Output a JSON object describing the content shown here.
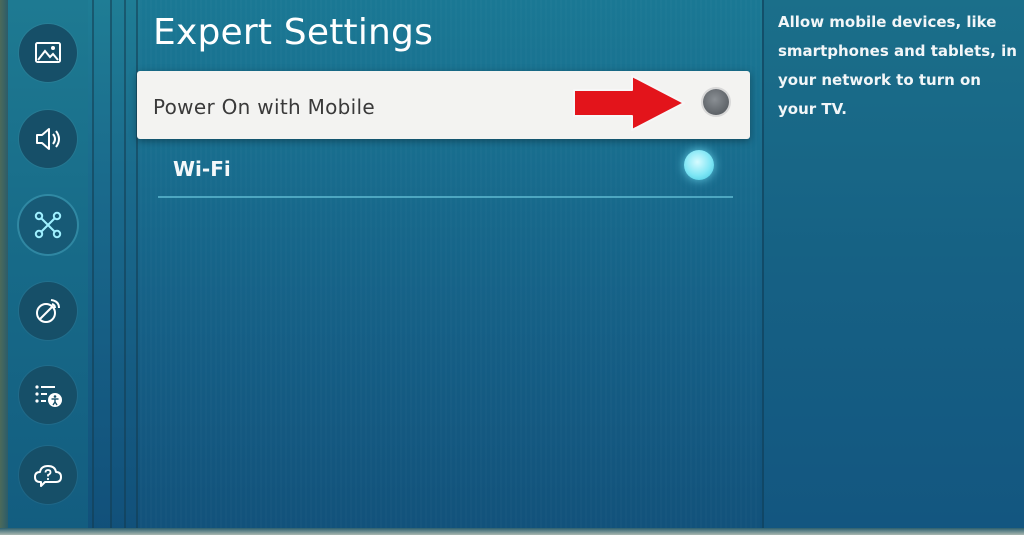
{
  "page": {
    "title": "Expert Settings"
  },
  "nav": {
    "items": [
      {
        "icon": "picture-icon"
      },
      {
        "icon": "sound-icon"
      },
      {
        "icon": "network-icon",
        "active": true
      },
      {
        "icon": "support-satellite-icon"
      },
      {
        "icon": "accessibility-list-icon"
      },
      {
        "icon": "help-cloud-icon"
      }
    ]
  },
  "settings": {
    "items": [
      {
        "label": "Power On with Mobile",
        "toggle": "off",
        "focused": true
      },
      {
        "label": "Wi-Fi",
        "toggle": "on",
        "focused": false
      }
    ]
  },
  "description": {
    "text": "Allow mobile devices, like smartphones and tablets, in your network to turn on your TV."
  },
  "colors": {
    "background": "#186d8e",
    "focus_row": "#f3f3f1",
    "toggle_on": "#7fe6f5",
    "toggle_off": "#5e6368",
    "annotation_arrow": "#e3141b"
  },
  "annotation": {
    "icon": "red-arrow-icon"
  }
}
